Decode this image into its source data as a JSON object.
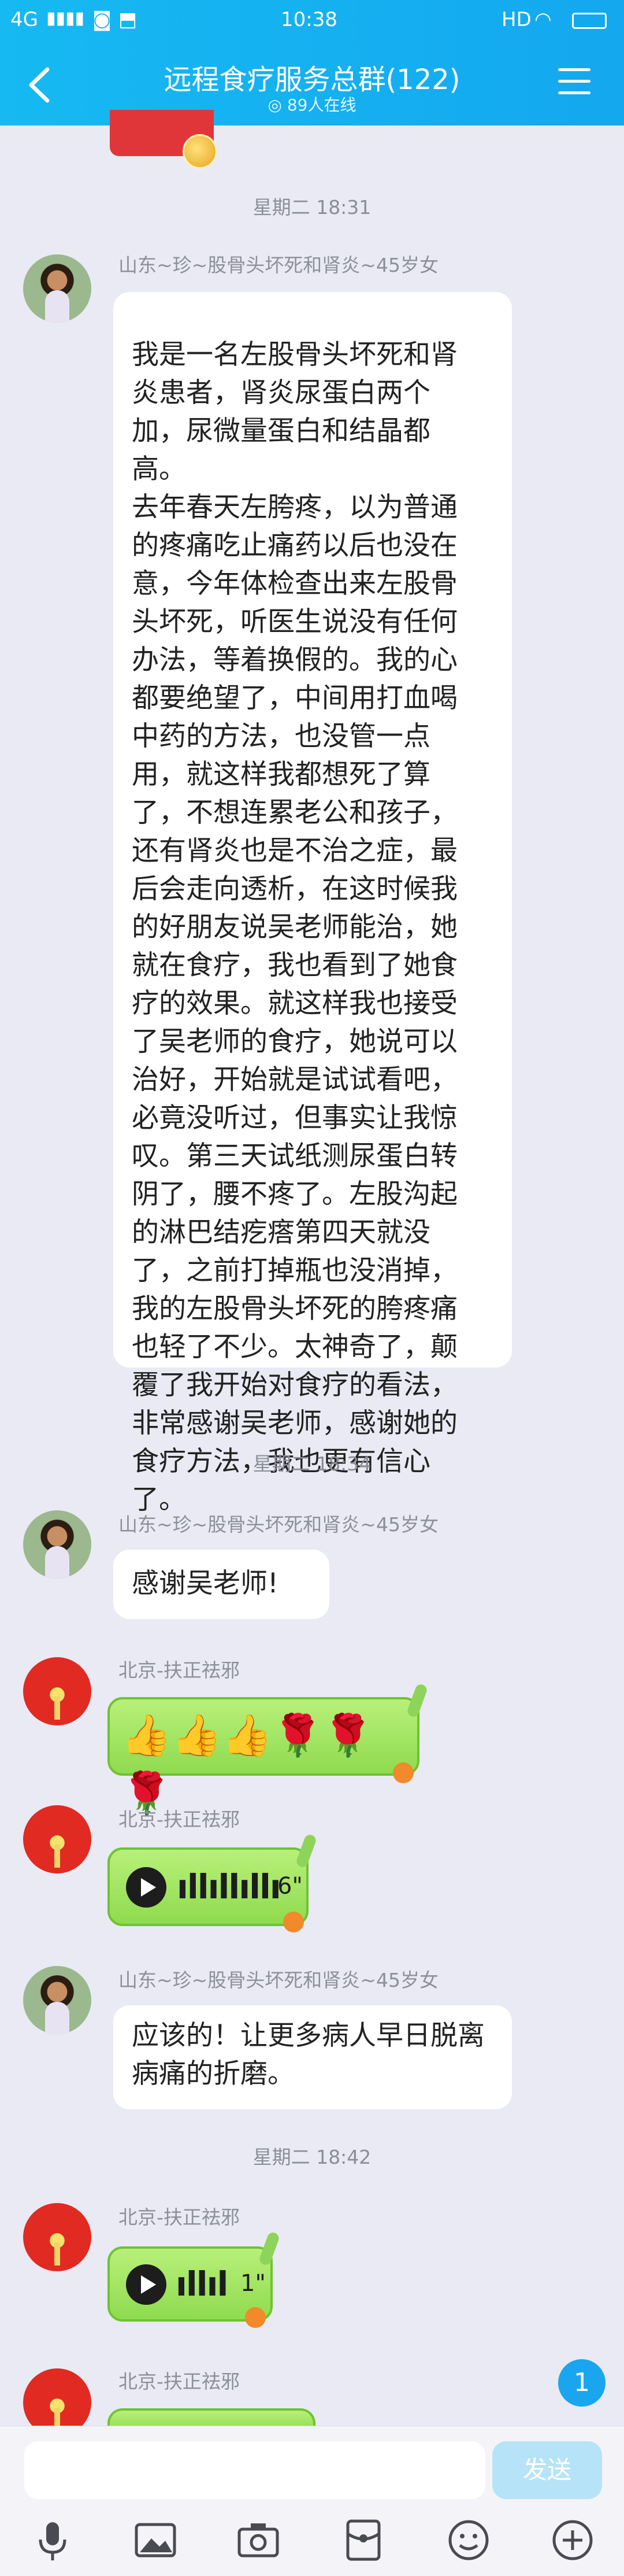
{
  "status_bar": {
    "network": "4G",
    "time": "10:38",
    "right": "HD"
  },
  "header": {
    "title": "远程食疗服务总群(122)",
    "online": "89人在线",
    "back_icon": "chevron-left-icon",
    "menu_icon": "menu-icon"
  },
  "messages": [
    {
      "type": "timestamp",
      "text": "星期二 18:31"
    },
    {
      "type": "text",
      "sender": "山东~珍~股骨头坏死和肾炎~45岁女",
      "text": "我是一名左股骨头坏死和肾炎患者，肾炎尿蛋白两个加，尿微量蛋白和结晶都高。\n去年春天左胯疼，以为普通的疼痛吃止痛药以后也没在意，今年体检查出来左股骨头坏死，听医生说没有任何办法，等着换假的。我的心都要绝望了，中间用打血喝中药的方法，也没管一点用，就这样我都想死了算了，不想连累老公和孩子，还有肾炎也是不治之症，最后会走向透析，在这时候我的好朋友说吴老师能治，她就在食疗，我也看到了她食疗的效果。就这样我也接受了吴老师的食疗，她说可以治好，开始就是试试看吧，必竟没听过，但事实让我惊叹。第三天试纸测尿蛋白转阴了，腰不疼了。左股沟起的淋巴结疙瘩第四天就没了，之前打掉瓶也没消掉，我的左股骨头坏死的胯疼痛也轻了不少。太神奇了，颠覆了我开始对食疗的看法，非常感谢吴老师，感谢她的食疗方法，我也更有信心了。"
    },
    {
      "type": "timestamp",
      "text": "星期二 18:34"
    },
    {
      "type": "text",
      "sender": "山东~珍~股骨头坏死和肾炎~45岁女",
      "text": "感谢吴老师!"
    },
    {
      "type": "emoji",
      "sender": "北京-扶正祛邪",
      "emoji": "👍👍👍🌹🌹🌹"
    },
    {
      "type": "voice",
      "sender": "北京-扶正祛邪",
      "duration": "6\""
    },
    {
      "type": "text",
      "sender": "山东~珍~股骨头坏死和肾炎~45岁女",
      "text": "应该的！让更多病人早日脱离病痛的折磨。"
    },
    {
      "type": "timestamp",
      "text": "星期二 18:42"
    },
    {
      "type": "voice",
      "sender": "北京-扶正祛邪",
      "duration": "1\""
    },
    {
      "type": "partial",
      "sender": "北京-扶正祛邪"
    }
  ],
  "unread_badge": "1",
  "input": {
    "placeholder": "",
    "send_label": "发送"
  },
  "toolbar": [
    "microphone-icon",
    "image-icon",
    "camera-icon",
    "red-packet-icon",
    "emoji-icon",
    "plus-icon"
  ]
}
